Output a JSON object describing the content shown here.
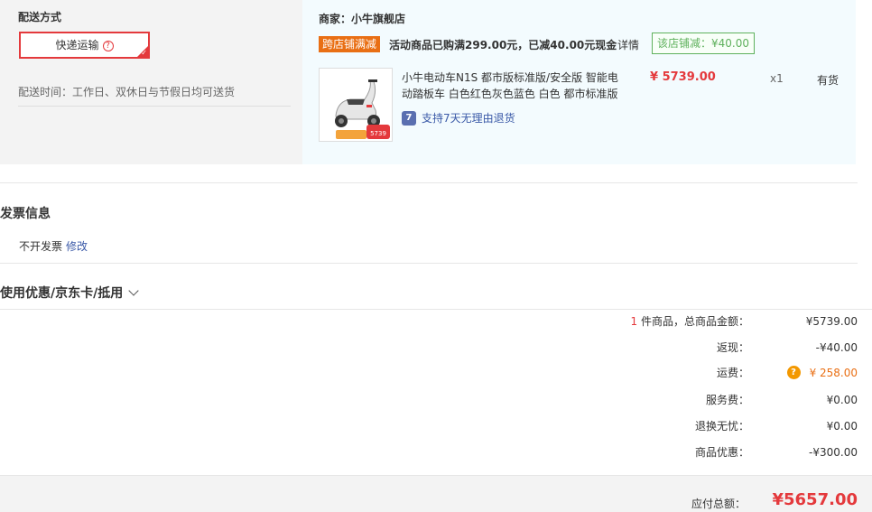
{
  "shipping": {
    "title": "配送方式",
    "option_label": "快递运输",
    "option_help": "?",
    "time_text": "配送时间：工作日、双休日与节假日均可送货"
  },
  "shop": {
    "name": "商家：小牛旗舰店",
    "promo_tag": "跨店铺满减",
    "promo_text": "活动商品已购满299.00元，已减40.00元现金",
    "promo_detail": "详情",
    "promo_badge": "该店铺减：¥40.00"
  },
  "product": {
    "title": "小牛电动车N1S 都市版标准版/安全版 智能电动踏板车 白色红色灰色蓝色 白色 都市标准版",
    "price": "¥ 5739.00",
    "qty": "x1",
    "stock": "有货",
    "return_icon": "7",
    "return_text": "支持7天无理由退货",
    "img_price": "5739"
  },
  "invoice": {
    "title": "发票信息",
    "status": "不开发票",
    "edit": "修改"
  },
  "coupon": {
    "title": "使用优惠/京东卡/抵用"
  },
  "summary": {
    "count": "1",
    "count_label": " 件商品，总商品金额：",
    "goods_total": "¥5739.00",
    "rebate_label": "返现：",
    "rebate_value": "-¥40.00",
    "freight_label": "运费：",
    "freight_value": "¥ 258.00",
    "service_label": "服务费：",
    "service_value": "¥0.00",
    "worry_label": "退换无忧：",
    "worry_value": "¥0.00",
    "discount_label": "商品优惠：",
    "discount_value": "-¥300.00",
    "total_label": "应付总额：",
    "total_value": "¥5657.00"
  },
  "colors": {
    "accent_red": "#e4393c",
    "promo_orange": "#e96f14",
    "badge_green": "#5fb15d",
    "link_blue": "#3b5aa8"
  }
}
